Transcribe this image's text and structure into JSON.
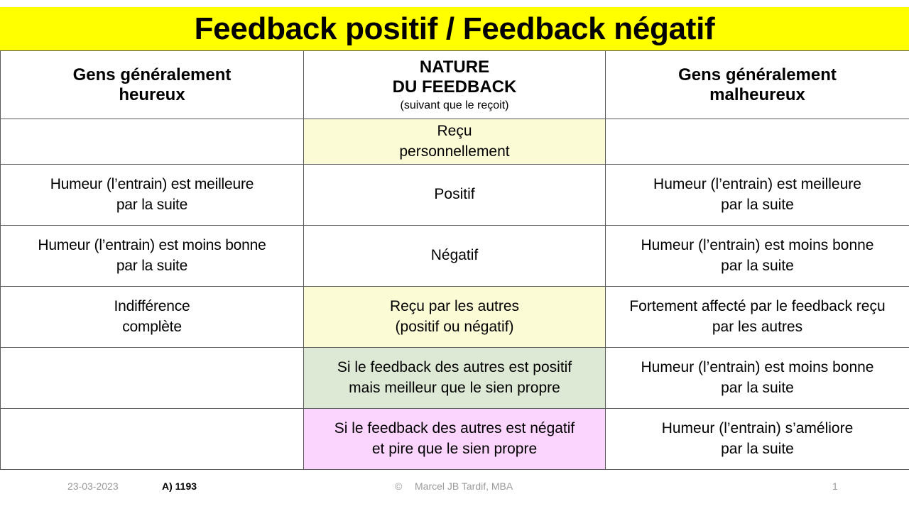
{
  "title": "Feedback positif / Feedback négatif",
  "colors": {
    "banner": "#FFFF00",
    "tint_yellow": "#FBFBD5",
    "tint_green": "#DEE9D5",
    "tint_pink": "#FBD5FD",
    "grid_line": "#595959",
    "footer_text": "#9A9A9A"
  },
  "table": {
    "headers": {
      "left": "Gens généralement\nheureux",
      "left_line1": "Gens généralement",
      "left_line2": "heureux",
      "middle_line1": "NATURE",
      "middle_line2": "DU FEEDBACK",
      "middle_sub": "(suivant que le reçoit)",
      "right_line1": "Gens généralement",
      "right_line2": "malheureux"
    },
    "rows": [
      {
        "left": "",
        "left_fill": "white",
        "middle_line1": "Reçu",
        "middle_line2": "personnellement",
        "middle_fill": "yellow",
        "right_line1": "",
        "right_line2": "",
        "right_fill": "white"
      },
      {
        "left_line1": "Humeur (l’entrain) est meilleure",
        "left_line2": "par la suite",
        "left_fill": "white",
        "middle_line1": "Positif",
        "middle_line2": "",
        "middle_fill": "white",
        "right_line1": "Humeur (l’entrain) est meilleure",
        "right_line2": "par la suite",
        "right_fill": "white"
      },
      {
        "left_line1": "Humeur (l’entrain) est moins bonne",
        "left_line2": "par la suite",
        "left_fill": "white",
        "middle_line1": "Négatif",
        "middle_line2": "",
        "middle_fill": "white",
        "right_line1": "Humeur (l’entrain) est moins bonne",
        "right_line2": "par la suite",
        "right_fill": "white"
      },
      {
        "left_line1": "Indifférence",
        "left_line2": "complète",
        "left_fill": "white",
        "middle_line1": "Reçu par les autres",
        "middle_line2": "(positif ou négatif)",
        "middle_fill": "yellow",
        "right_line1": "Fortement affecté par le feedback reçu",
        "right_line2": "par les autres",
        "right_fill": "white"
      },
      {
        "left_line1": "",
        "left_line2": "",
        "left_fill": "white",
        "middle_line1": "Si le feedback des autres est positif",
        "middle_line2": "mais meilleur que le sien propre",
        "middle_fill": "green",
        "right_line1": "Humeur (l’entrain) est moins bonne",
        "right_line2": "par la suite",
        "right_fill": "white"
      },
      {
        "left_line1": "",
        "left_line2": "",
        "left_fill": "white",
        "middle_line1": "Si le feedback des autres est négatif",
        "middle_line2": "et pire que le sien propre",
        "middle_fill": "pink",
        "right_line1": "Humeur (l’entrain) s’améliore",
        "right_line2": "par la suite",
        "right_fill": "white"
      }
    ]
  },
  "footer": {
    "date": "23-03-2023",
    "reference": "A) 1193",
    "copyright_symbol": "©",
    "author": "Marcel JB Tardif, MBA",
    "page_number": "1"
  }
}
